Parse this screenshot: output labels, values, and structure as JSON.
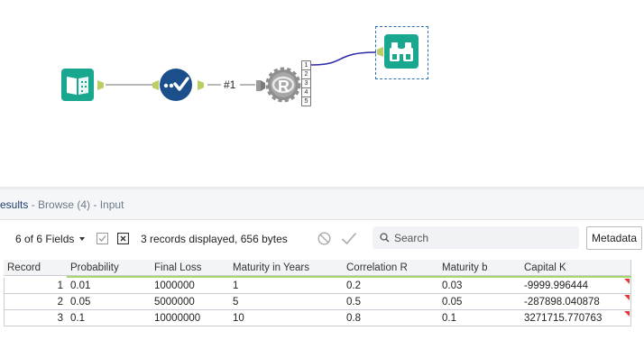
{
  "canvas": {
    "connection_label": "#1",
    "r_anchors": [
      "1",
      "2",
      "3",
      "4",
      "5"
    ],
    "r_label": "R"
  },
  "results": {
    "title_prefix": "esults",
    "title_suffix": "- Browse (4) - Input"
  },
  "toolbar": {
    "fields_label": "6 of 6 Fields",
    "records_info": "3 records displayed, 656 bytes",
    "search_placeholder": "Search",
    "metadata_label": "Metadata"
  },
  "grid": {
    "columns": [
      "Record",
      "Probability",
      "Final Loss",
      "Maturity in Years",
      "Correlation R",
      "Maturity b",
      "Capital K"
    ],
    "rows": [
      [
        "1",
        "0.01",
        "1000000",
        "1",
        "0.2",
        "0.03",
        "-9999.996444"
      ],
      [
        "2",
        "0.05",
        "5000000",
        "5",
        "0.5",
        "0.05",
        "-287898.040878"
      ],
      [
        "3",
        "0.1",
        "10000000",
        "10",
        "0.8",
        "0.1",
        "3271715.770763"
      ]
    ]
  },
  "colors": {
    "tool_teal": "#1aa78f",
    "tool_blue": "#1a4f8c",
    "anchor_green": "#b9cf64",
    "connector_blue": "#2a2aa8",
    "header_green_line": "#a6d86e"
  }
}
